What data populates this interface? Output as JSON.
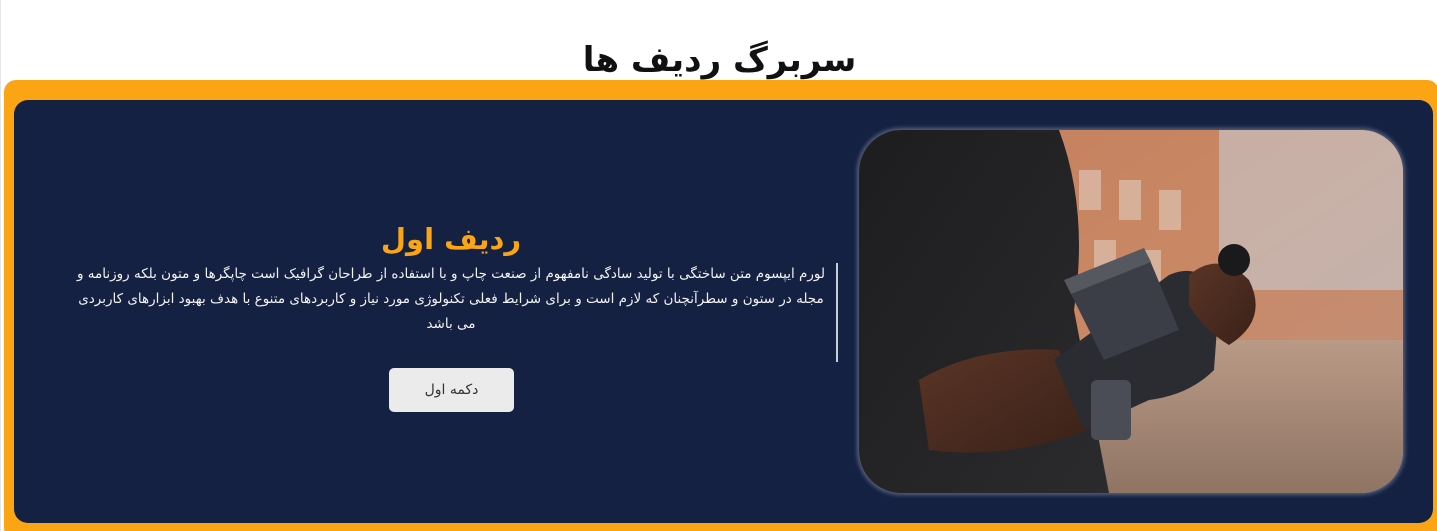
{
  "header": {
    "title": "سربرگ ردیف ها"
  },
  "card": {
    "title": "ردیف اول",
    "description": "لورم ایپسوم متن ساختگی با تولید سادگی نامفهوم از صنعت چاپ و با استفاده از طراحان گرافیک است چاپگرها و متون بلکه روزنامه و مجله در ستون و سطرآنچنان که لازم است و برای شرایط فعلی تکنولوژی مورد نیاز و کاربردهای متنوع با هدف بهبود ابزارهای کاربردی می باشد",
    "button_label": "دکمه اول",
    "image_icon": "photo-person-holding-camera-rig"
  },
  "colors": {
    "accent": "#fba515",
    "card_background": "#152142",
    "button_background": "#ebebeb"
  }
}
